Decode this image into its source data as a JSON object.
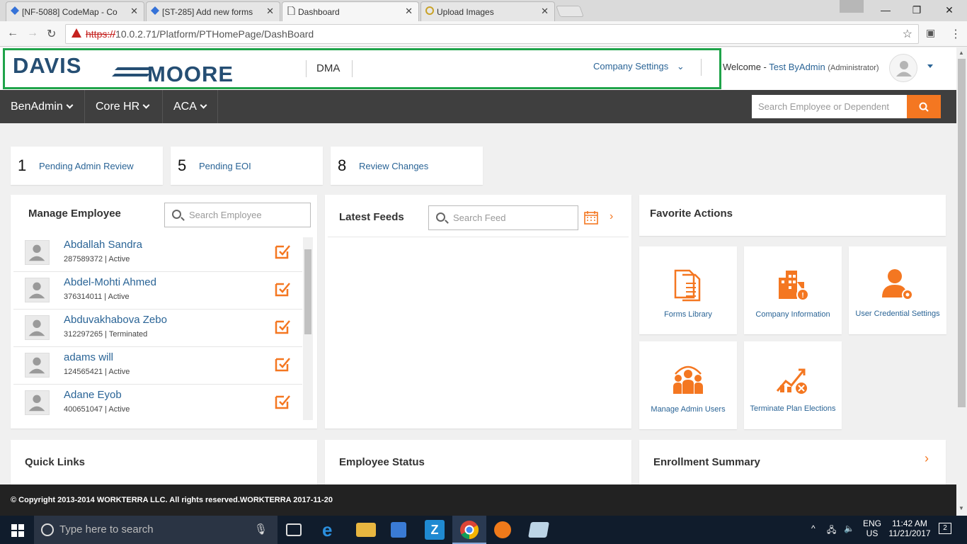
{
  "browser": {
    "tabs": [
      {
        "title": "[NF-5088] CodeMap - Co",
        "close": "✕"
      },
      {
        "title": "[ST-285] Add new forms",
        "close": "✕"
      },
      {
        "title": "Dashboard",
        "close": "✕"
      },
      {
        "title": "Upload Images",
        "close": "✕"
      }
    ],
    "url_scheme": "https://",
    "url_rest": "10.0.2.71/Platform/PTHomePage/DashBoard"
  },
  "header": {
    "logo_text": "DAVIS MOORE",
    "org": "DMA",
    "company_settings": "Company Settings",
    "welcome": "Welcome -",
    "user": "Test ByAdmin",
    "role": "(Administrator)"
  },
  "nav": {
    "items": [
      "BenAdmin",
      "Core HR",
      "ACA"
    ],
    "search_placeholder": "Search Employee or Dependent"
  },
  "stats": [
    {
      "count": "1",
      "label": "Pending Admin Review"
    },
    {
      "count": "5",
      "label": "Pending EOI"
    },
    {
      "count": "8",
      "label": "Review Changes"
    }
  ],
  "manage_employee": {
    "title": "Manage Employee",
    "search_placeholder": "Search Employee",
    "employees": [
      {
        "name": "Abdallah Sandra",
        "info": "287589372 | Active"
      },
      {
        "name": "Abdel-Mohti Ahmed",
        "info": "376314011 | Active"
      },
      {
        "name": "Abduvakhabova Zebo",
        "info": "312297265 | Terminated"
      },
      {
        "name": "adams will",
        "info": "124565421 | Active"
      },
      {
        "name": "Adane Eyob",
        "info": "400651047 | Active"
      }
    ]
  },
  "latest_feeds": {
    "title": "Latest Feeds",
    "search_placeholder": "Search Feed"
  },
  "favorite_actions": {
    "title": "Favorite Actions",
    "items": [
      {
        "label": "Forms Library",
        "icon": "forms-icon"
      },
      {
        "label": "Company Information",
        "icon": "building-icon"
      },
      {
        "label": "User Credential Settings",
        "icon": "user-gear-icon"
      },
      {
        "label": "Manage Admin Users",
        "icon": "users-icon"
      },
      {
        "label": "Terminate Plan Elections",
        "icon": "chart-cancel-icon"
      }
    ]
  },
  "bottom_panels": {
    "quick_links": "Quick Links",
    "employee_status": "Employee Status",
    "enrollment_summary": "Enrollment Summary"
  },
  "footer": "© Copyright 2013-2014 WORKTERRA LLC. All rights reserved.WORKTERRA 2017-11-20",
  "taskbar": {
    "search_placeholder": "Type here to search",
    "lang": "ENG",
    "region": "US",
    "time": "11:42 AM",
    "date": "11/21/2017",
    "notifications": "2"
  },
  "colors": {
    "accent": "#f47721",
    "link": "#2a6496",
    "navbar": "#3f3f3f",
    "highlight": "#1fa34a"
  }
}
